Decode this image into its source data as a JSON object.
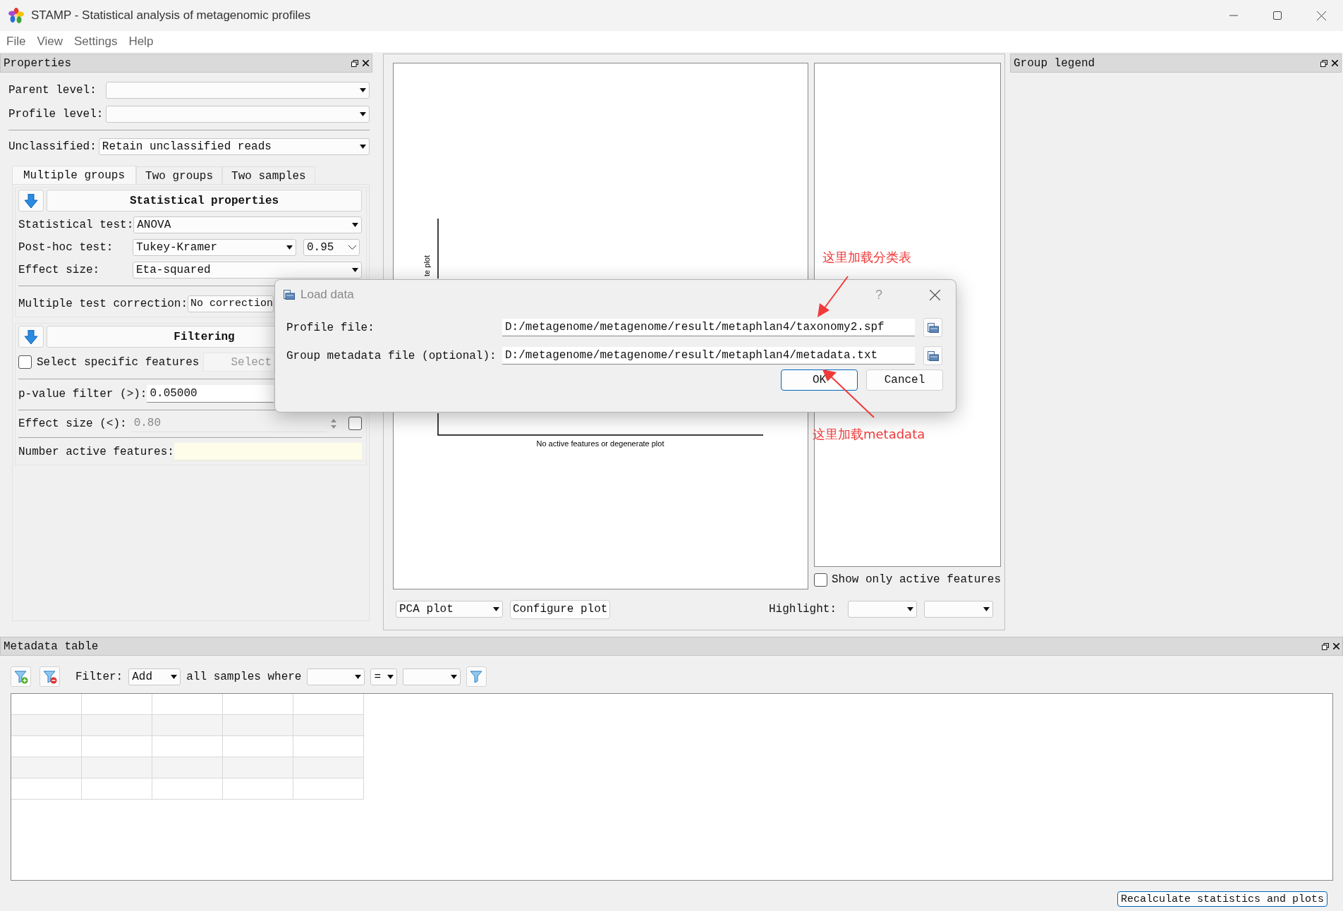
{
  "window": {
    "title": "STAMP - Statistical analysis of metagenomic profiles"
  },
  "menu": [
    "File",
    "View",
    "Settings",
    "Help"
  ],
  "properties": {
    "title": "Properties",
    "levels": [
      {
        "label": "Parent level:"
      },
      {
        "label": "Profile level:"
      }
    ],
    "unclassified": {
      "label": "Unclassified:",
      "value": "Retain unclassified reads"
    },
    "tabs": [
      {
        "label": "Multiple groups",
        "selected": true
      },
      {
        "label": "Two groups",
        "selected": false
      },
      {
        "label": "Two samples",
        "selected": false
      }
    ],
    "statistical": {
      "title": "Statistical properties",
      "fields": [
        {
          "label": "Statistical test:",
          "value": "ANOVA"
        },
        {
          "label": "Post-hoc test:",
          "value": "Tukey-Kramer",
          "confidence": "0.95"
        },
        {
          "label": "Effect size:",
          "value": "Eta-squared"
        }
      ],
      "correction": {
        "label": "Multiple test correction:",
        "value": "No correction"
      }
    },
    "filtering": {
      "title": "Filtering",
      "select_features": {
        "label": "Select specific features",
        "checked": false,
        "button": "Select"
      },
      "p_value": {
        "label": "p-value filter (>):",
        "value": "0.05000"
      },
      "effect_size": {
        "label": "Effect size (<):",
        "value": "0.80",
        "disabled": true,
        "checked": false
      },
      "active_features": {
        "label": "Number active features:"
      }
    }
  },
  "plot": {
    "y_label": "te plot",
    "caption": "No active features or degenerate plot",
    "show_active": {
      "label": "Show only active features",
      "checked": false
    },
    "plot_type": "PCA plot",
    "configure": "Configure plot",
    "highlight": "Highlight:"
  },
  "group_legend": {
    "title": "Group legend"
  },
  "metadata": {
    "title": "Metadata table",
    "filter_label": "Filter:",
    "filter_mode": "Add",
    "where_label": "all samples where",
    "operator": "="
  },
  "recalculate": "Recalculate statistics and plots",
  "dialog": {
    "title": "Load data",
    "help": "?",
    "fields": [
      {
        "label": "Profile file:",
        "value": "D:/metagenome/metagenome/result/metaphlan4/taxonomy2.spf"
      },
      {
        "label": "Group metadata file (optional):",
        "value": "D:/metagenome/metagenome/result/metaphlan4/metadata.txt"
      }
    ],
    "buttons": [
      {
        "label": "OK",
        "default": true
      },
      {
        "label": "Cancel",
        "default": false
      }
    ]
  },
  "annotations": [
    {
      "text": "这里加载分类表"
    },
    {
      "text": "这里加载metadata"
    }
  ]
}
